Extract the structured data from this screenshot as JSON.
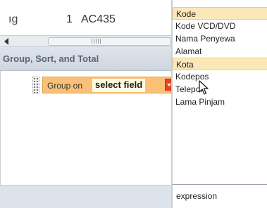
{
  "datasheet": {
    "left_text": "ıg",
    "record_number": "1",
    "record_code": "AC435"
  },
  "group_pane": {
    "title": "Group, Sort, and Total",
    "group_on_label": "Group on",
    "field_value": "select field"
  },
  "field_dropdown": {
    "items": [
      {
        "label": "Kode",
        "highlighted": true
      },
      {
        "label": "Kode VCD/DVD",
        "highlighted": false
      },
      {
        "label": "Nama Penyewa",
        "highlighted": false
      },
      {
        "label": "Alamat",
        "highlighted": false
      },
      {
        "label": "Kota",
        "highlighted": true
      },
      {
        "label": "Kodepos",
        "highlighted": false
      },
      {
        "label": "Telepon",
        "highlighted": false
      },
      {
        "label": "Lama Pinjam",
        "highlighted": false
      }
    ],
    "footer": "expression"
  },
  "colors": {
    "group_box": "#f8c177",
    "dropdown_button": "#e4451f",
    "highlight": "#fbe7b8"
  },
  "icons": [
    "scroll-left-arrow-icon",
    "scrollbar-grip-icon",
    "drag-handle-icon",
    "dropdown-arrow-icon",
    "mouse-cursor-icon"
  ]
}
